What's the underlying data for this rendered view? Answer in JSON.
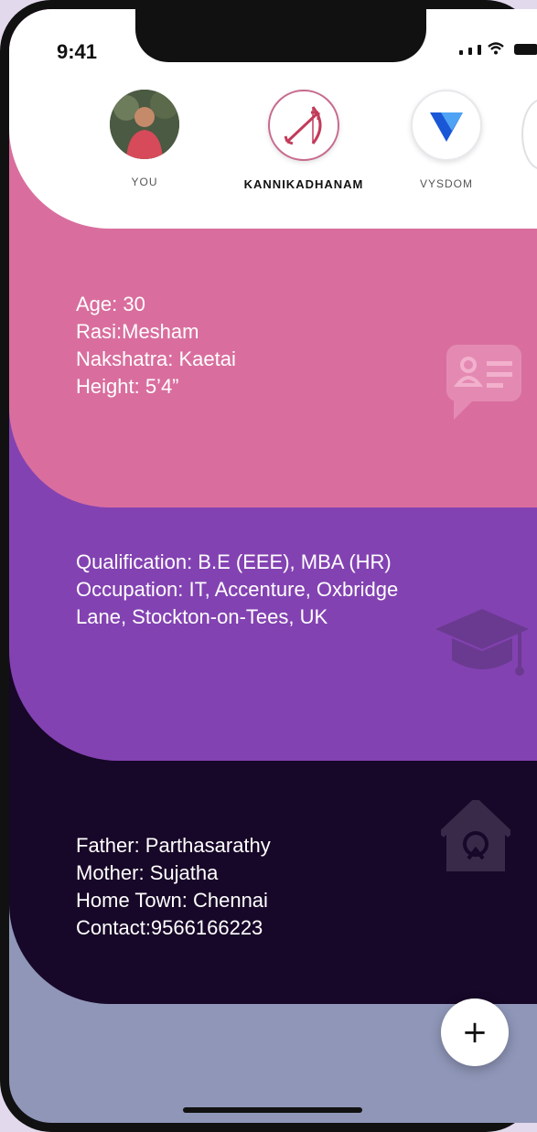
{
  "status_bar": {
    "time": "9:41"
  },
  "stories": [
    {
      "name": "YOU",
      "icon": "profile-photo"
    },
    {
      "name": "KANNIKADHANAM",
      "icon": "bow-arrow-logo"
    },
    {
      "name": "VYSDOM",
      "icon": "blue-v-logo"
    }
  ],
  "cards": {
    "personal": {
      "text": "Age: 30\nRasi:Mesham\nNakshatra: Kaetai\nHeight: 5’4”",
      "icon": "profile-card-icon",
      "color": "#d96e9e"
    },
    "career": {
      "text": "Qualification: B.E (EEE), MBA (HR)\nOccupation: IT, Accenture, Oxbridge Lane, Stockton-on-Tees, UK",
      "icon": "graduation-cap-icon",
      "color": "#8342b2"
    },
    "family": {
      "text": "Father: Parthasarathy\nMother: Sujatha\nHome Town: Chennai\nContact:9566166223",
      "icon": "home-icon",
      "color": "#170728"
    }
  },
  "fab": {
    "label": "+"
  }
}
